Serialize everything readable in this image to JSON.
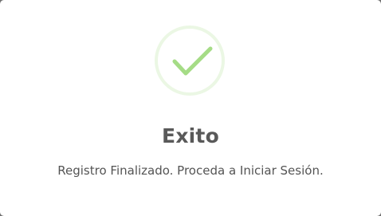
{
  "dialog": {
    "icon": "success-check-icon",
    "icon_color": "#a5dc86",
    "title": "Exito",
    "message": "Registro Finalizado. Proceda a Iniciar Sesión."
  }
}
